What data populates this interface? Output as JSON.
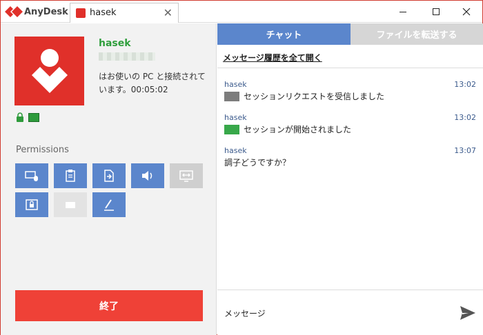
{
  "titlebar": {
    "app_title": "AnyDesk",
    "tab_label": "hasek",
    "tab_close": "✕"
  },
  "user": {
    "name": "hasek",
    "status": "はお使いの PC と接続されています。00:05:02"
  },
  "permissions": {
    "heading": "Permissions",
    "items": [
      {
        "icon": "keyboard-mouse-icon",
        "enabled": true
      },
      {
        "icon": "clipboard-icon",
        "enabled": true
      },
      {
        "icon": "file-transfer-icon",
        "enabled": true
      },
      {
        "icon": "sound-icon",
        "enabled": true
      },
      {
        "icon": "switch-sides-icon",
        "enabled": false
      },
      {
        "icon": "lock-screen-icon",
        "enabled": true
      },
      {
        "icon": "camera-icon",
        "enabled": false
      },
      {
        "icon": "draw-icon",
        "enabled": true
      }
    ]
  },
  "end_button": "終了",
  "chat": {
    "tab_chat": "チャット",
    "tab_files": "ファイルを転送する",
    "history_link": "メッセージ履歴を全て開く",
    "messages": [
      {
        "sender": "hasek",
        "time": "13:02",
        "text": "セッションリクエストを受信しました",
        "icon": "session-request-icon"
      },
      {
        "sender": "hasek",
        "time": "13:02",
        "text": "セッションが開始されました",
        "icon": "session-started-icon"
      },
      {
        "sender": "hasek",
        "time": "13:07",
        "text": "調子どうですか？",
        "icon": ""
      }
    ],
    "input_placeholder": "メッセージ"
  },
  "colors": {
    "accent_red": "#e0302a",
    "accent_blue": "#5b86cc",
    "accent_green": "#2f9e3c"
  }
}
